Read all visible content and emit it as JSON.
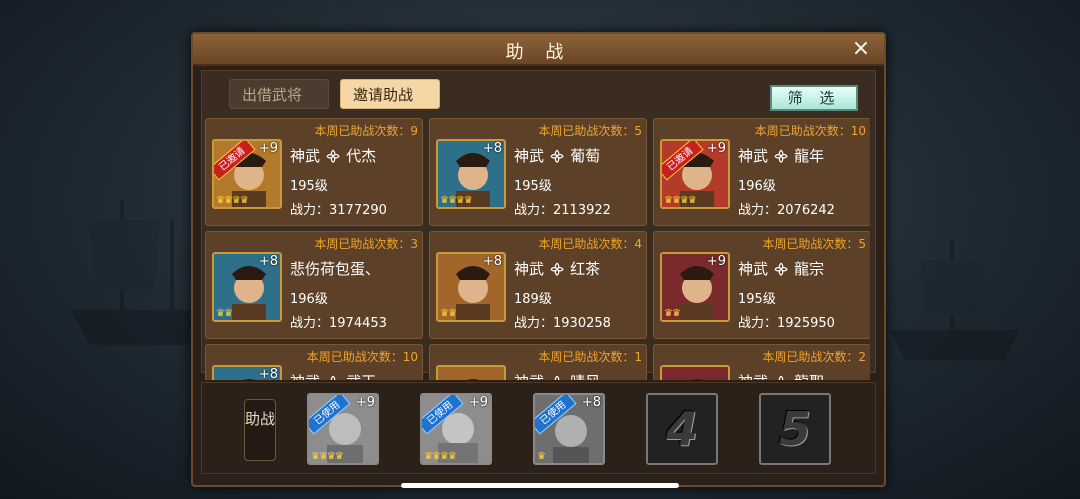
{
  "modal": {
    "title": "助 战",
    "close_icon": "×"
  },
  "tabs": [
    {
      "label": "出借武将",
      "active": false
    },
    {
      "label": "邀请助战",
      "active": true
    }
  ],
  "filter_label": "筛 选",
  "cards": [
    {
      "count": "本周已助战次数：9",
      "name": "神武 ᯽ 代杰",
      "level": "195级",
      "power": "战力：3177290",
      "plus": "+9",
      "stars": "♛♛♛♛",
      "ribbon": "已邀请",
      "color": "#b27a2a"
    },
    {
      "count": "本周已助战次数：5",
      "name": "神武 ᯽ 葡萄",
      "level": "195级",
      "power": "战力：2113922",
      "plus": "+8",
      "stars": "♛♛♛♛",
      "ribbon": "",
      "color": "#2e6f8a"
    },
    {
      "count": "本周已助战次数：10",
      "name": "神武 ᯽ 龍年",
      "level": "196级",
      "power": "战力：2076242",
      "plus": "+9",
      "stars": "♛♛♛♛",
      "ribbon": "已邀请",
      "color": "#b33b2a"
    },
    {
      "count": "本周已助战次数：3",
      "name": "悲伤荷包蛋、",
      "level": "196级",
      "power": "战力：1974453",
      "plus": "+8",
      "stars": "♛♛",
      "ribbon": "",
      "color": "#2e6f8a"
    },
    {
      "count": "本周已助战次数：4",
      "name": "神武 ᯽ 红茶",
      "level": "189级",
      "power": "战力：1930258",
      "plus": "+8",
      "stars": "♛♛",
      "ribbon": "",
      "color": "#a2652a"
    },
    {
      "count": "本周已助战次数：5",
      "name": "神武 ᯽ 龍宗",
      "level": "195级",
      "power": "战力：1925950",
      "plus": "+9",
      "stars": "♛♛",
      "ribbon": "",
      "color": "#7a2a2a"
    },
    {
      "count": "本周已助战次数：10",
      "name": "神武 ᯽ 武王",
      "level": "",
      "power": "",
      "plus": "+8",
      "stars": "",
      "ribbon": "",
      "color": "#2e6f8a"
    },
    {
      "count": "本周已助战次数：1",
      "name": "神武 ᯽ 晴风",
      "level": "",
      "power": "",
      "plus": "",
      "stars": "",
      "ribbon": "",
      "color": "#a2652a"
    },
    {
      "count": "本周已助战次数：2",
      "name": "神武 ᯽ 龍聖",
      "level": "",
      "power": "",
      "plus": "",
      "stars": "",
      "ribbon": "",
      "color": "#7a2a2a"
    }
  ],
  "footer": {
    "label": "助战",
    "slots": [
      {
        "plus": "+9",
        "ribbon": "已使用",
        "stars": "♛♛♛♛"
      },
      {
        "plus": "+9",
        "ribbon": "已使用",
        "stars": "♛♛♛♛"
      },
      {
        "plus": "+8",
        "ribbon": "已使用",
        "stars": "♛"
      },
      {
        "number": "4"
      },
      {
        "number": "5"
      }
    ]
  }
}
